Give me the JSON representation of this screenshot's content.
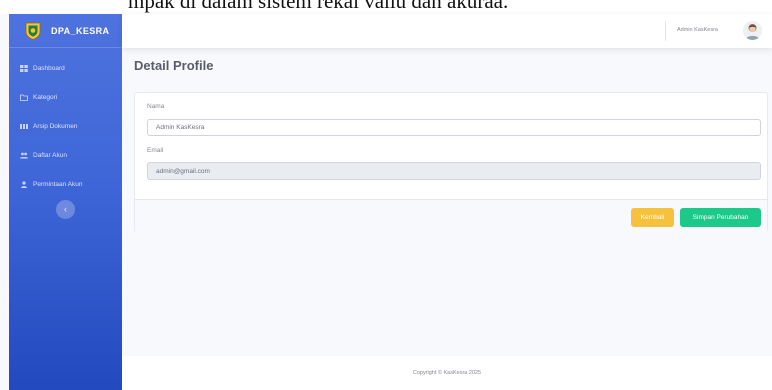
{
  "caption": {
    "text": "mpak di dalam sistem rekai vallu dan akuraa."
  },
  "brand": {
    "name": "DPA_KESRA",
    "icon": "emblem-logo"
  },
  "sidebar": {
    "items": [
      {
        "label": "Dashboard",
        "icon": "dashboard-icon"
      },
      {
        "label": "Kategori",
        "icon": "folder-icon"
      },
      {
        "label": "Arsip Dokumen",
        "icon": "archive-icon"
      },
      {
        "label": "Daftar Akun",
        "icon": "users-icon"
      },
      {
        "label": "Permintaan Akun",
        "icon": "user-icon"
      }
    ],
    "toggle_icon": "‹"
  },
  "topbar": {
    "user_name": "Admin KasKesra"
  },
  "page": {
    "title": "Detail Profile"
  },
  "form": {
    "nama_label": "Nama",
    "nama_value": "Admin KasKesra",
    "email_label": "Email",
    "email_value": "admin@gmail.com"
  },
  "buttons": {
    "back": "Kembali",
    "save": "Simpan Perubahan"
  },
  "footer": {
    "copyright": "Copyright © KasKesra 2025"
  },
  "colors": {
    "sidebar": "#4e73df",
    "warning": "#f6c23e",
    "success": "#1cc88a"
  }
}
